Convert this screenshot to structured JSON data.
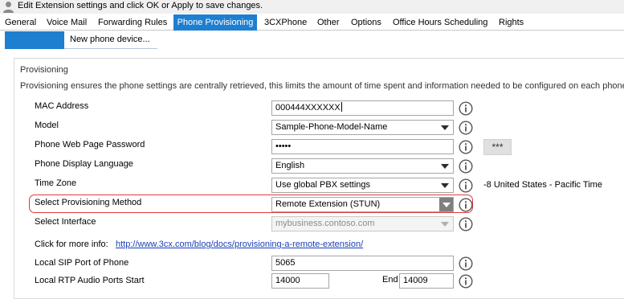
{
  "header": {
    "title": "Edit Extension settings and click OK or Apply to save changes.",
    "icon": "user-icon"
  },
  "tabs": [
    {
      "label": "General"
    },
    {
      "label": "Voice Mail"
    },
    {
      "label": "Forwarding Rules"
    },
    {
      "label": "Phone Provisioning",
      "active": true
    },
    {
      "label": "3CXPhone"
    },
    {
      "label": "Other"
    },
    {
      "label": "Options"
    },
    {
      "label": "Office Hours Scheduling"
    },
    {
      "label": "Rights"
    }
  ],
  "subtabs": {
    "new_device_label": "New phone device..."
  },
  "provisioning": {
    "legend": "Provisioning",
    "description": "Provisioning ensures the phone settings are centrally retrieved, this limits the amount of time spent and information needed to be configured on each phone.",
    "mac_label": "MAC Address",
    "mac_value": "000444XXXXXX",
    "model_label": "Model",
    "model_value": "Sample-Phone-Model-Name",
    "password_label": "Phone Web Page Password",
    "password_value": "•••••",
    "password_button": "***",
    "language_label": "Phone Display Language",
    "language_value": "English",
    "timezone_label": "Time Zone",
    "timezone_value": "Use global PBX settings",
    "timezone_info": "-8 United States - Pacific Time",
    "method_label": "Select Provisioning Method",
    "method_value": "Remote Extension (STUN)",
    "interface_label": "Select Interface",
    "interface_value": "mybusiness.contoso.com",
    "more_info_label": "Click for more info:",
    "more_info_link": "http://www.3cx.com/blog/docs/provisioning-a-remote-extension/",
    "sip_port_label": "Local SIP Port of Phone",
    "sip_port_value": "5065",
    "rtp_label": "Local RTP Audio Ports Start",
    "rtp_start_value": "14000",
    "rtp_end_label": "End",
    "rtp_end_value": "14009"
  },
  "colors": {
    "accent": "#1e7fd0",
    "highlight": "#e03a3a",
    "link": "#1a3fb5"
  }
}
